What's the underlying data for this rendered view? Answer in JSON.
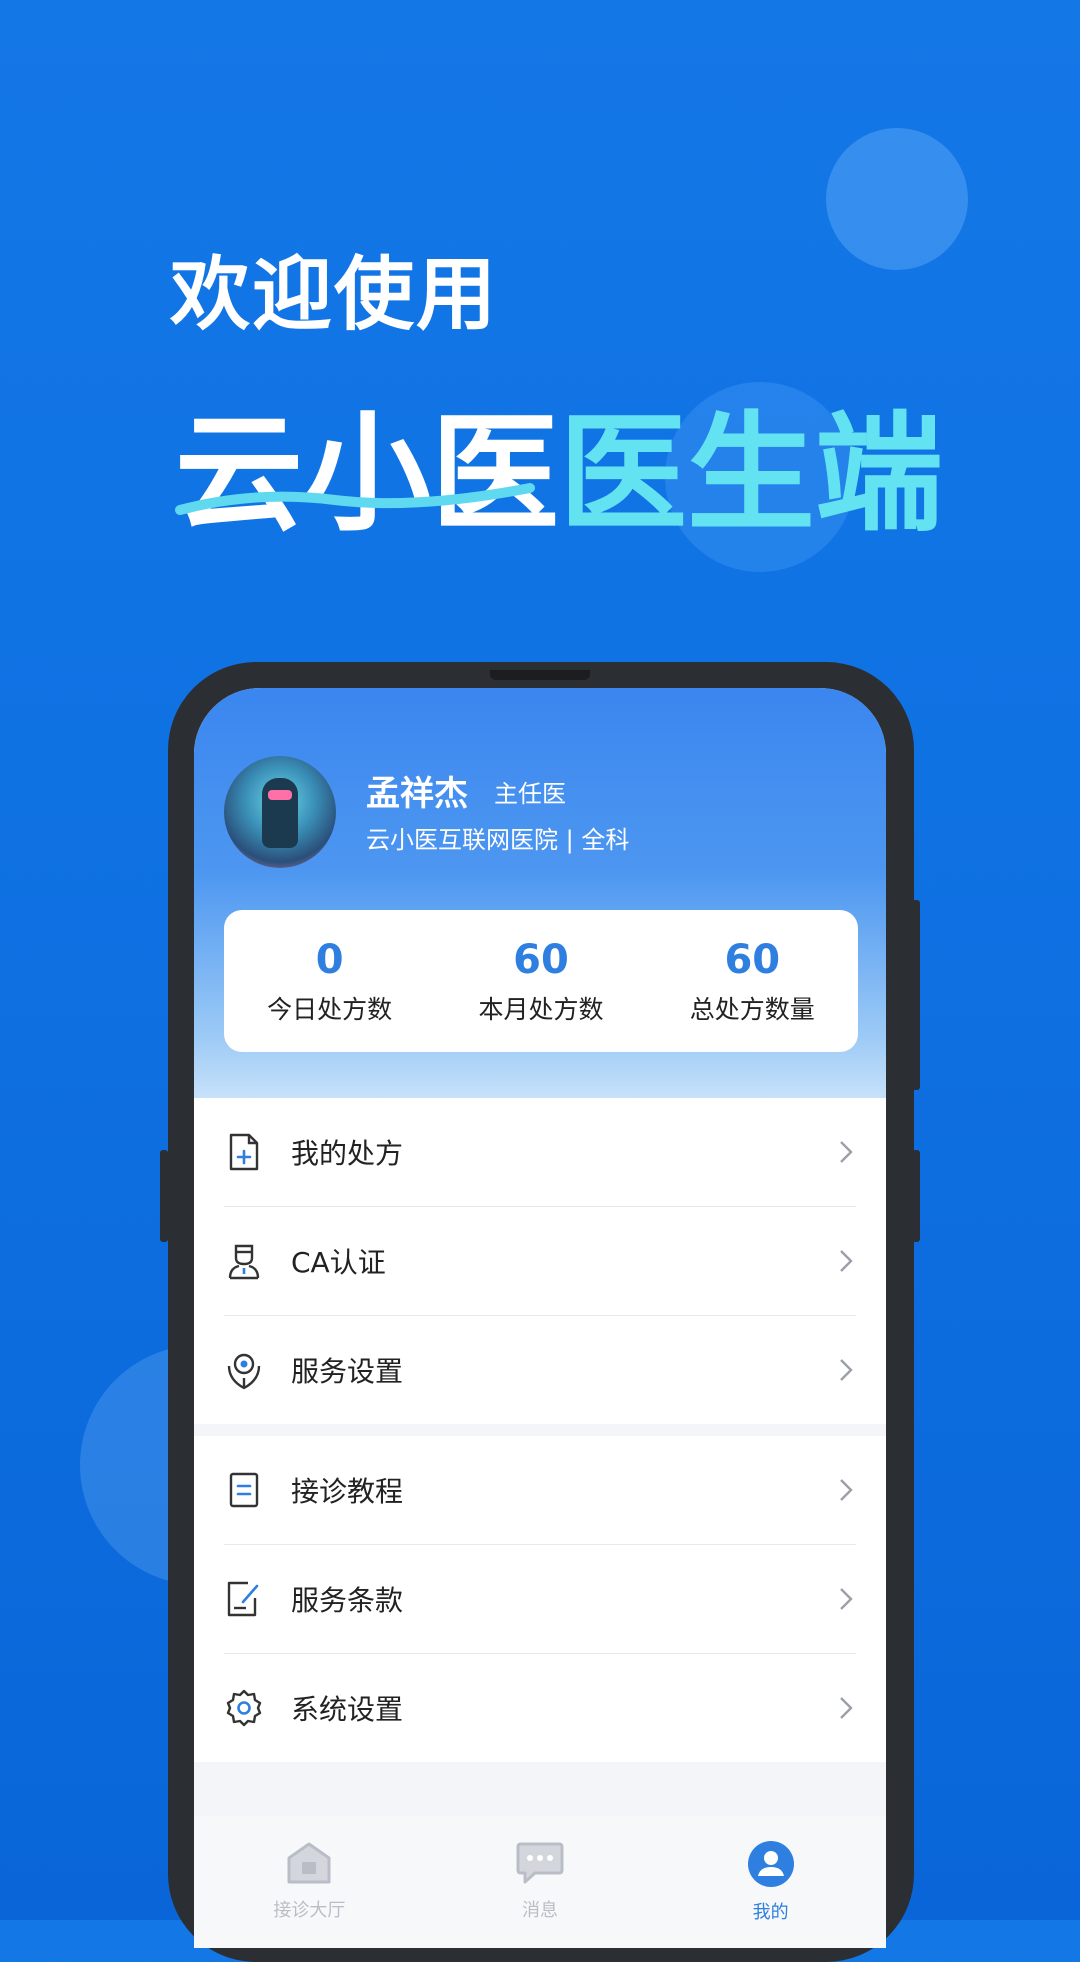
{
  "hero": {
    "welcome": "欢迎使用",
    "brand_white": "云小医",
    "brand_cyan": "医生端"
  },
  "profile": {
    "name": "孟祥杰",
    "title": "主任医",
    "hospital": "云小医互联网医院 | 全科"
  },
  "stats": [
    {
      "value": "0",
      "label": "今日处方数"
    },
    {
      "value": "60",
      "label": "本月处方数"
    },
    {
      "value": "60",
      "label": "总处方数量"
    }
  ],
  "menu_group_1": [
    {
      "label": "我的处方",
      "icon": "prescription-icon"
    },
    {
      "label": "CA认证",
      "icon": "doctor-icon"
    },
    {
      "label": "服务设置",
      "icon": "location-settings-icon"
    }
  ],
  "menu_group_2": [
    {
      "label": "接诊教程",
      "icon": "document-icon"
    },
    {
      "label": "服务条款",
      "icon": "edit-document-icon"
    },
    {
      "label": "系统设置",
      "icon": "gear-icon"
    }
  ],
  "tabbar": {
    "items": [
      {
        "label": "接诊大厅",
        "icon": "home-icon",
        "active": false
      },
      {
        "label": "消息",
        "icon": "chat-icon",
        "active": false
      },
      {
        "label": "我的",
        "icon": "user-icon",
        "active": true
      }
    ]
  },
  "colors": {
    "background": "#1477e6",
    "accent_cyan": "#63e3f2",
    "stat_blue": "#2f7fe0",
    "tab_active": "#2f7fe0",
    "tab_inactive": "#b9bec6"
  }
}
